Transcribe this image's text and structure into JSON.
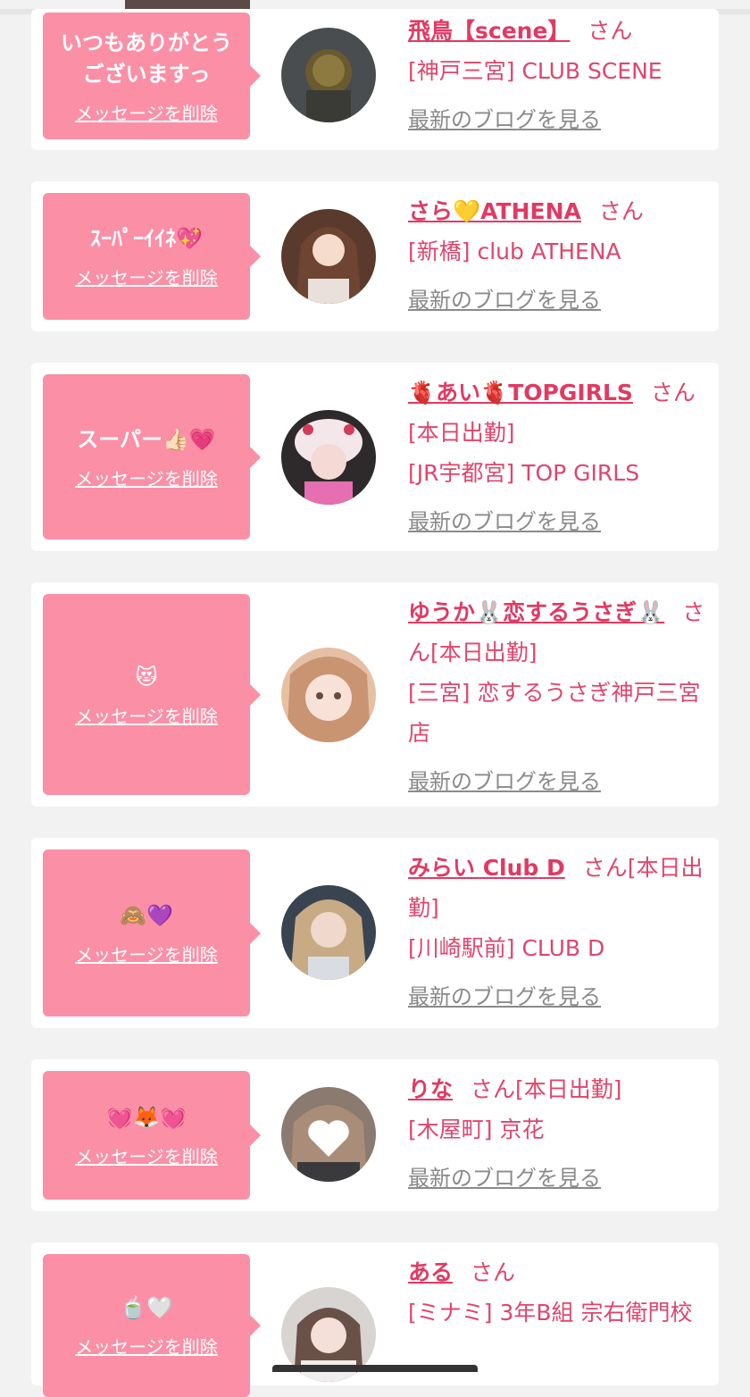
{
  "items": [
    {
      "message": "いつもありがとう\nございますっ",
      "delete_label": "メッセージを削除",
      "name": "飛鳥【scene】",
      "san": "さん",
      "shop": "[神戸三宮] CLUB SCENE",
      "blog_label": "最新のブログを見る"
    },
    {
      "message": "ｽｰﾊﾟｰｲｲﾈ💖",
      "delete_label": "メッセージを削除",
      "name": "さら💛ATHENA",
      "san": "さん",
      "shop": "[新橋] club ATHENA",
      "blog_label": "最新のブログを見る"
    },
    {
      "message": "スーパー👍🏻💗",
      "delete_label": "メッセージを削除",
      "name": "🫀あい🫀TOPGIRLS",
      "san": "さん[本日出勤]",
      "shop": "[JR宇都宮] TOP GIRLS",
      "blog_label": "最新のブログを見る"
    },
    {
      "message": "😻",
      "delete_label": "メッセージを削除",
      "name": "ゆうか🐰恋するうさぎ🐰",
      "san": "さん[本日出勤]",
      "shop": "[三宮] 恋するうさぎ神戸三宮店",
      "blog_label": "最新のブログを見る"
    },
    {
      "message": "🙈💜",
      "delete_label": "メッセージを削除",
      "name": "みらい Club D",
      "san": "さん[本日出勤]",
      "shop": "[川崎駅前] CLUB D",
      "blog_label": "最新のブログを見る"
    },
    {
      "message": "💓🦊💓",
      "delete_label": "メッセージを削除",
      "name": "りな",
      "san": "さん[本日出勤]",
      "shop": "[木屋町] 京花",
      "blog_label": "最新のブログを見る"
    },
    {
      "message": "🍵🤍",
      "delete_label": "メッセージを削除",
      "name": "ある",
      "san": "さん",
      "shop": "[ミナミ] 3年B組 宗右衛門校",
      "blog_label": ""
    }
  ]
}
